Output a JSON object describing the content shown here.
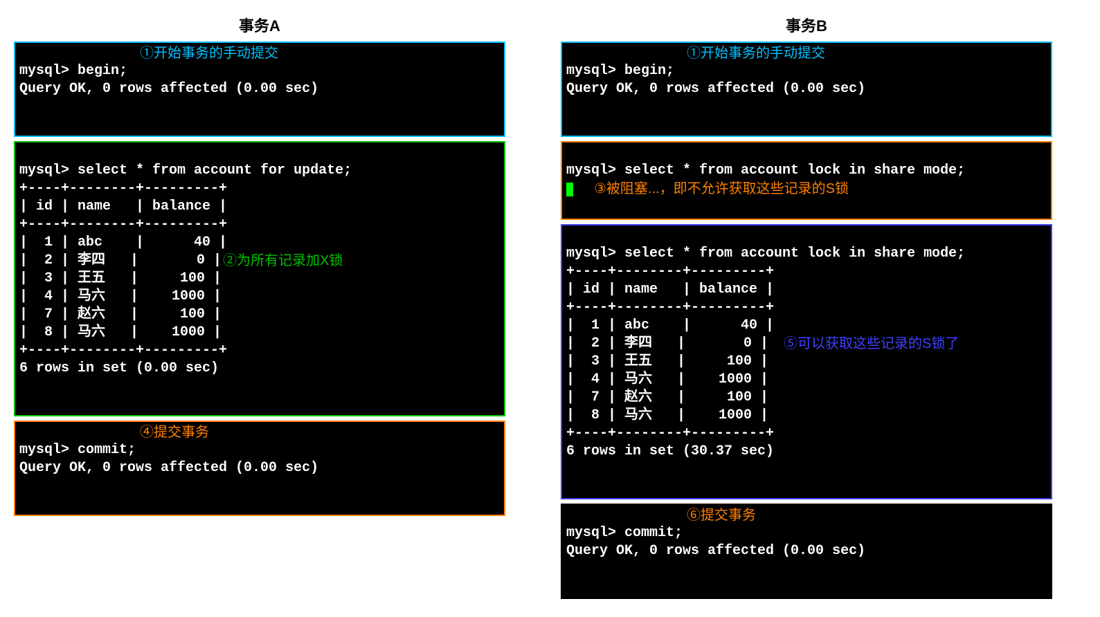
{
  "a": {
    "title": "事务A",
    "begin1": "mysql> begin;",
    "begin2": "Query OK, 0 rows affected (0.00 sec)",
    "annot1": "①开始事务的手动提交",
    "sel_prompt": "mysql> select * from account for update;",
    "table_header": "| id | name   | balance |",
    "table_sep": "+----+--------+---------+",
    "rows": [
      "|  1 | abc    |      40 |",
      "|  2 | 李四   |       0 |",
      "|  3 | 王五   |     100 |",
      "|  4 | 马六   |    1000 |",
      "|  7 | 赵六   |     100 |",
      "|  8 | 马六   |    1000 |"
    ],
    "count": "6 rows in set (0.00 sec)",
    "annot2": "②为所有记录加X锁",
    "commit1": "mysql> commit;",
    "commit2": "Query OK, 0 rows affected (0.00 sec)",
    "annot4": "④提交事务"
  },
  "b": {
    "title": "事务B",
    "begin1": "mysql> begin;",
    "begin2": "Query OK, 0 rows affected (0.00 sec)",
    "annot1": "①开始事务的手动提交",
    "sel_blocked": "mysql> select * from account lock in share mode;",
    "annot3": "③被阻塞...，即不允许获取这些记录的S锁",
    "sel_prompt": "mysql> select * from account lock in share mode;",
    "table_header": "| id | name   | balance |",
    "table_sep": "+----+--------+---------+",
    "rows": [
      "|  1 | abc    |      40 |",
      "|  2 | 李四   |       0 |",
      "|  3 | 王五   |     100 |",
      "|  4 | 马六   |    1000 |",
      "|  7 | 赵六   |     100 |",
      "|  8 | 马六   |    1000 |"
    ],
    "count": "6 rows in set (30.37 sec)",
    "annot5": "⑤可以获取这些记录的S锁了",
    "commit1": "mysql> commit;",
    "commit2": "Query OK, 0 rows affected (0.00 sec)",
    "annot6": "⑥提交事务"
  }
}
